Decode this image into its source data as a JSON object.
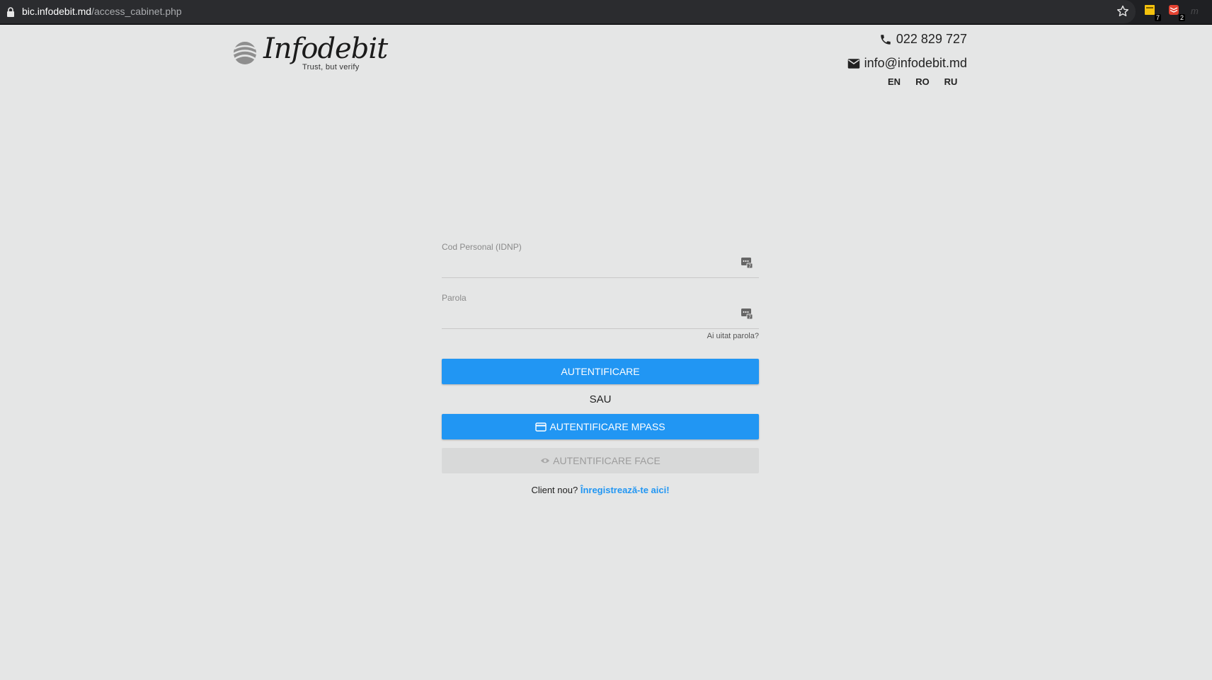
{
  "browser": {
    "url_host": "bic.infodebit.md",
    "url_path": "/access_cabinet.php",
    "extensions": [
      {
        "name": "sticky-notes-extension",
        "badge": "7",
        "color": "#f4c20d"
      },
      {
        "name": "todoist-extension",
        "badge": "2",
        "color": "#e44332"
      }
    ],
    "faded_extension_text": "m"
  },
  "header": {
    "logo_text": "Infodebit",
    "tagline": "Trust, but verify",
    "phone": "022 829 727",
    "email": "info@infodebit.md",
    "languages": [
      "EN",
      "RO",
      "RU"
    ]
  },
  "form": {
    "idnp_label": "Cod Personal (IDNP)",
    "idnp_value": "",
    "password_label": "Parola",
    "password_value": "",
    "forgot_password": "Ai uitat parola?",
    "login_button": "AUTENTIFICARE",
    "or_text": "SAU",
    "mpass_button": "AUTENTIFICARE MPASS",
    "face_button": "AUTENTIFICARE FACE",
    "new_client_text": "Client nou?",
    "register_link": "Înregistrează-te aici!"
  },
  "colors": {
    "accent": "#2196f3",
    "background": "#e5e6e6",
    "disabled": "#d8d9d9"
  }
}
